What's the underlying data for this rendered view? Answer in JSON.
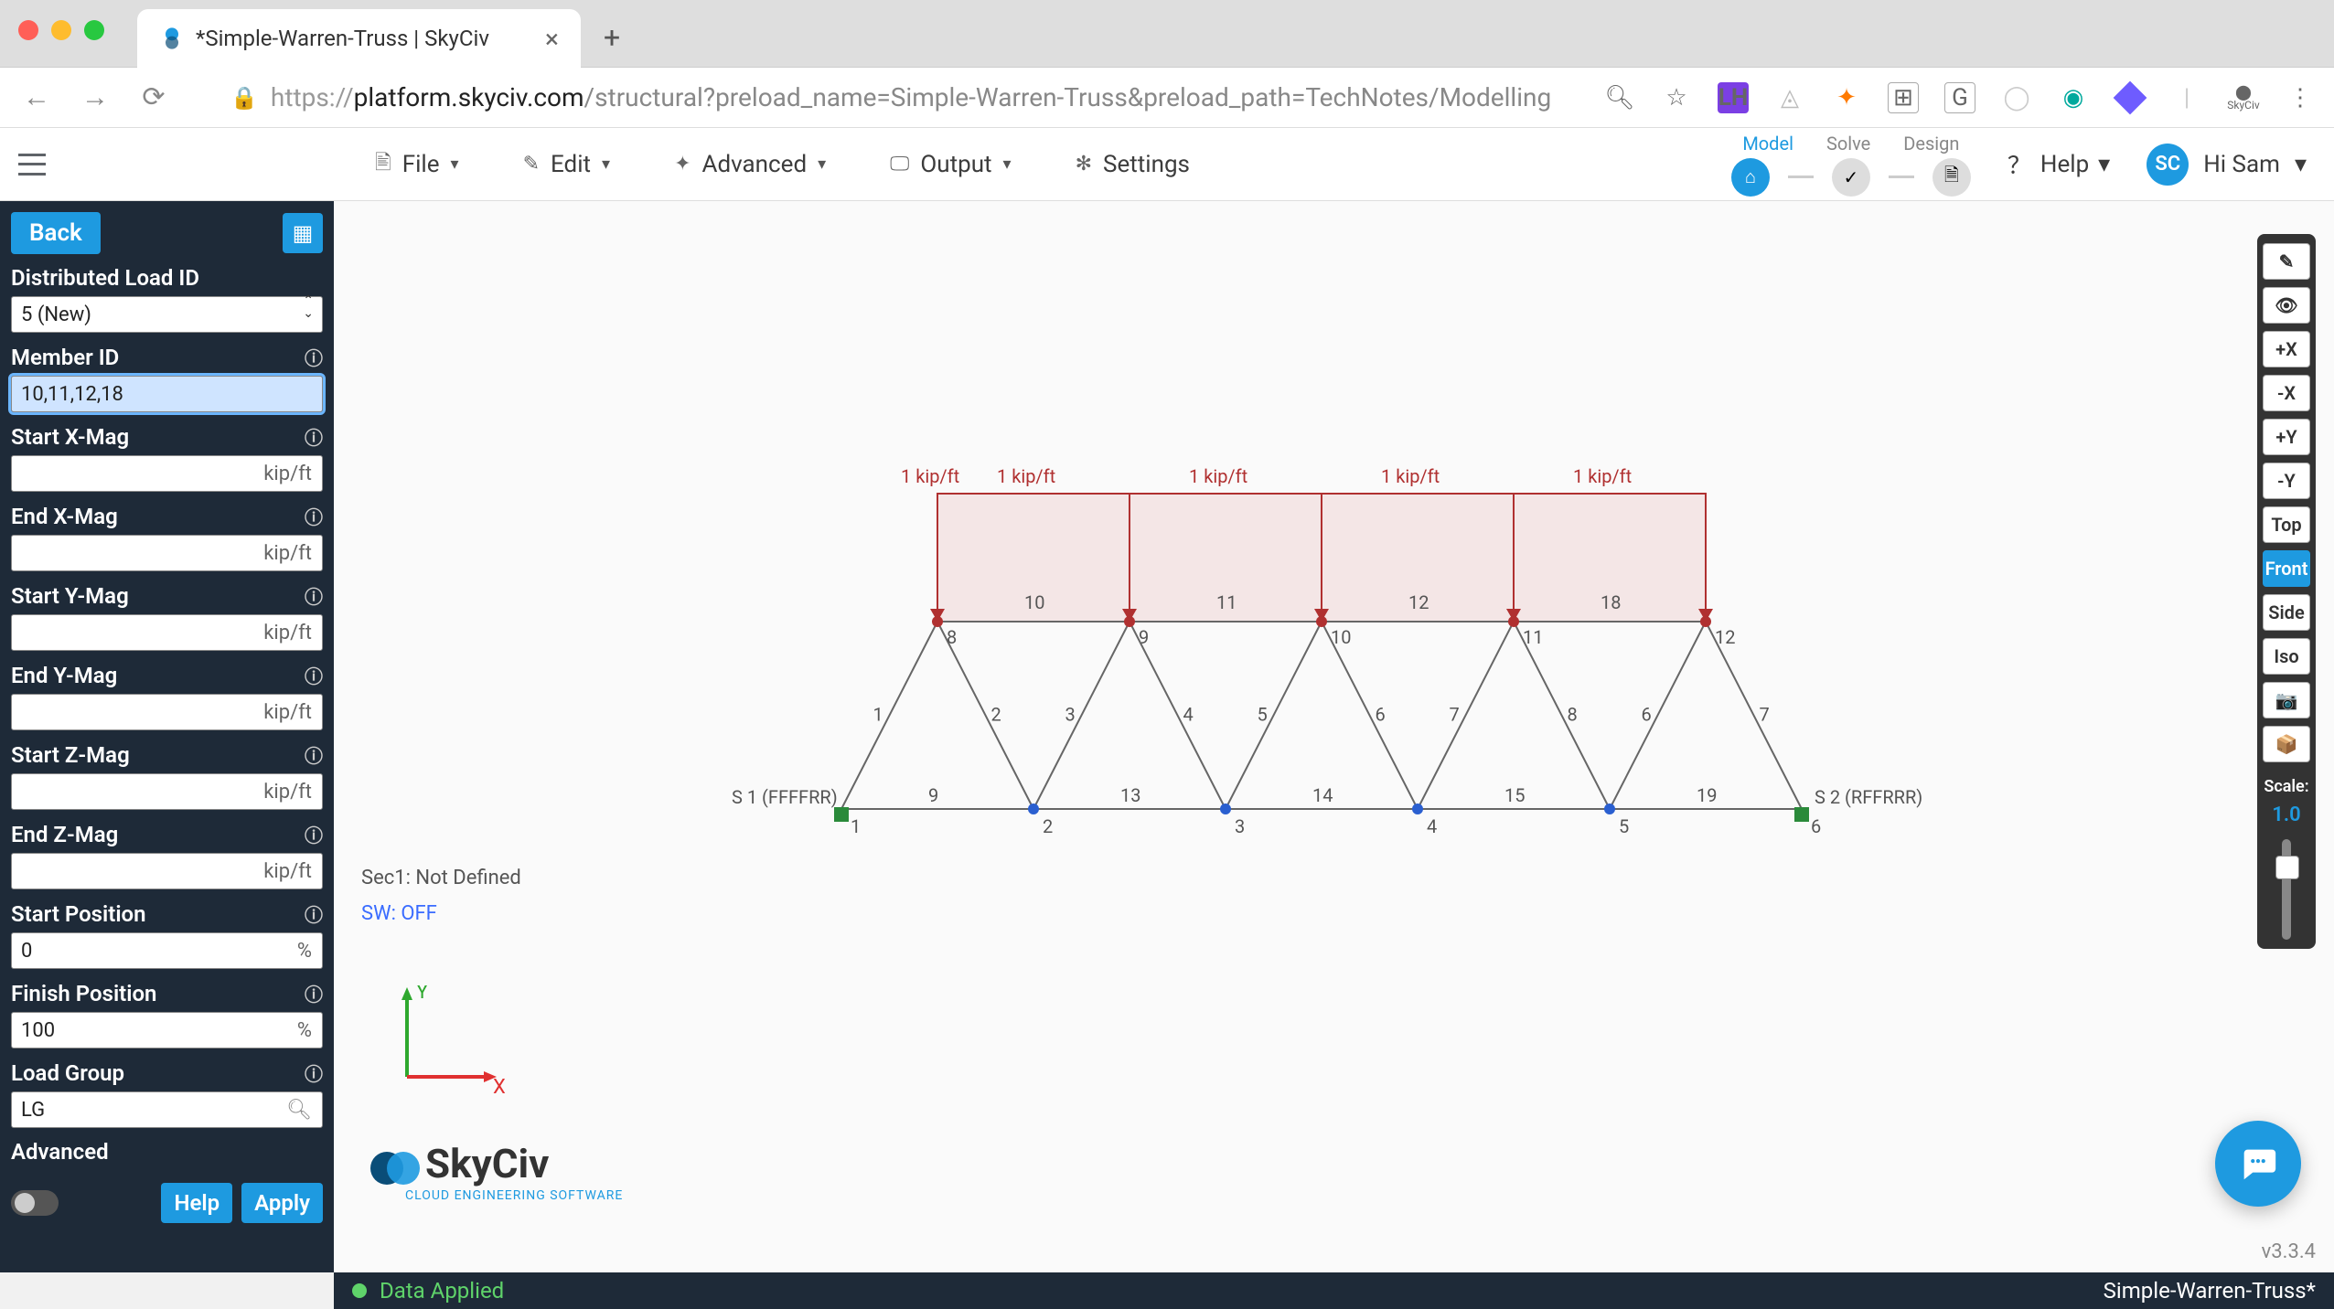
{
  "browser": {
    "tab_title": "*Simple-Warren-Truss | SkyCiv",
    "url_host": "platform.skyciv.com",
    "url_path": "/structural?preload_name=Simple-Warren-Truss&preload_path=TechNotes/Modelling",
    "ext_badge": "LH",
    "ext_brand": "SkyCiv"
  },
  "toolbar": {
    "file": "File",
    "edit": "Edit",
    "advanced": "Advanced",
    "output": "Output",
    "settings": "Settings",
    "msd": {
      "model": "Model",
      "solve": "Solve",
      "design": "Design"
    },
    "help": "Help",
    "user_initials": "SC",
    "user_greeting": "Hi Sam"
  },
  "sidebar": {
    "back": "Back",
    "dlid_label": "Distributed Load ID",
    "dlid_value": "5 (New)",
    "member_label": "Member ID",
    "member_value": "10,11,12,18",
    "sxmag_label": "Start X-Mag",
    "exmag_label": "End X-Mag",
    "symag_label": "Start Y-Mag",
    "eymag_label": "End Y-Mag",
    "szmag_label": "Start Z-Mag",
    "ezmag_label": "End Z-Mag",
    "unit": "kip/ft",
    "spos_label": "Start Position",
    "spos_value": "0",
    "fpos_label": "Finish Position",
    "fpos_value": "100",
    "pct": "%",
    "lg_label": "Load Group",
    "lg_value": "LG",
    "advanced": "Advanced",
    "help_btn": "Help",
    "apply_btn": "Apply"
  },
  "canvas": {
    "sec_label": "Sec1: Not Defined",
    "sw_label": "SW: OFF",
    "load_label": "1 kip/ft",
    "support_left": "S 1 (FFFFRR)",
    "support_right": "S 2 (RFFRRR)",
    "top_nodes": [
      "8",
      "9",
      "10",
      "11",
      "12"
    ],
    "top_members": [
      "10",
      "11",
      "12",
      "18"
    ],
    "diag_members": [
      "1",
      "2",
      "3",
      "4",
      "5",
      "6",
      "7",
      "8",
      "6",
      "7"
    ],
    "bottom_nodes": [
      "1",
      "2",
      "3",
      "4",
      "5",
      "6"
    ],
    "bottom_members": [
      "9",
      "13",
      "14",
      "15",
      "19"
    ],
    "axis_x": "X",
    "axis_y": "Y",
    "logo_name": "SkyCiv",
    "logo_tag": "CLOUD ENGINEERING SOFTWARE",
    "version": "v3.3.4"
  },
  "right_toolbar": {
    "buttons": [
      "✎",
      "👁",
      "+X",
      "-X",
      "+Y",
      "-Y",
      "Top",
      "Front",
      "Side",
      "Iso",
      "📷",
      "📦"
    ],
    "active_index": 7,
    "scale_label": "Scale:",
    "scale_value": "1.0"
  },
  "statusbar": {
    "message": "Data Applied",
    "filename": "Simple-Warren-Truss*"
  }
}
